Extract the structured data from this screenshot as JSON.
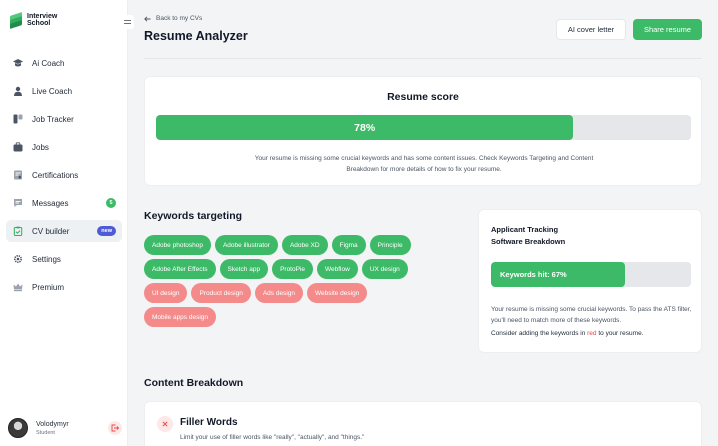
{
  "brand": {
    "line1": "Interview",
    "line2": "School"
  },
  "sidebar": {
    "items": [
      {
        "label": "Ai Coach",
        "icon": "graduation-cap-icon"
      },
      {
        "label": "Live Coach",
        "icon": "person-icon"
      },
      {
        "label": "Job Tracker",
        "icon": "tracker-icon"
      },
      {
        "label": "Jobs",
        "icon": "briefcase-icon"
      },
      {
        "label": "Certifications",
        "icon": "certificate-icon"
      },
      {
        "label": "Messages",
        "icon": "message-icon",
        "badge": "5"
      },
      {
        "label": "CV builder",
        "icon": "clipboard-icon",
        "badge": "new",
        "active": true
      },
      {
        "label": "Settings",
        "icon": "gear-icon"
      },
      {
        "label": "Premium",
        "icon": "crown-icon"
      }
    ]
  },
  "user": {
    "name": "Volodymyr",
    "role": "Student"
  },
  "header": {
    "back_label": "Back to my CVs",
    "title": "Resume Analyzer",
    "cover_letter_label": "AI cover letter",
    "share_label": "Share resume"
  },
  "score": {
    "title": "Resume score",
    "value_label": "78%",
    "percent": 78,
    "description": "Your resume is missing some crucial keywords and has some content issues. Check Keywords Targeting and Content Breakdown for more details of how to fix your resume."
  },
  "keywords": {
    "title": "Keywords targeting",
    "rows": [
      [
        {
          "label": "Adobe photoshop",
          "matched": true
        },
        {
          "label": "Adobe illustrator",
          "matched": true
        },
        {
          "label": "Adobe XD",
          "matched": true
        },
        {
          "label": "Figma",
          "matched": true
        },
        {
          "label": "Principle",
          "matched": true
        }
      ],
      [
        {
          "label": "Adobe After Effects",
          "matched": true
        },
        {
          "label": "Sketch app",
          "matched": true
        },
        {
          "label": "ProtoPie",
          "matched": true
        },
        {
          "label": "Webflow",
          "matched": true
        },
        {
          "label": "UX design",
          "matched": true
        }
      ],
      [
        {
          "label": "UI design",
          "matched": false
        },
        {
          "label": "Product design",
          "matched": false
        },
        {
          "label": "Ads design",
          "matched": false
        },
        {
          "label": "Website design",
          "matched": false
        }
      ],
      [
        {
          "label": "Mobile apps design",
          "matched": false
        }
      ]
    ]
  },
  "ats": {
    "title_line1": "Applicant Tracking",
    "title_line2": "Software Breakdown",
    "bar_label": "Keywords hit: 67%",
    "percent": 67,
    "description": "Your resume is missing some crucial keywords. To pass the ATS filter, you'll need to match more of these keywords.",
    "hint_before": "Consider adding the keywords in ",
    "hint_red": "red",
    "hint_after": " to your resume."
  },
  "content_breakdown": {
    "title": "Content Breakdown",
    "filler_title": "Filler Words",
    "filler_desc": "Limit your use of filler words like \"really\", \"actually\", and \"things.\""
  },
  "colors": {
    "accent": "#3cba67",
    "missing": "#f48a8a",
    "badge_new": "#4f5bd5",
    "hint_red": "#ef4444"
  }
}
